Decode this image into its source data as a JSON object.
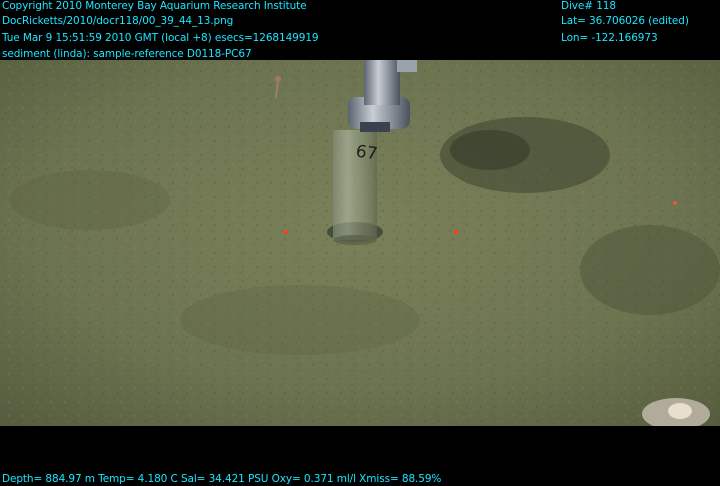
{
  "overlay": {
    "copyright": "Copyright 2010 Monterey Bay Aquarium Research Institute",
    "file_path": "DocRicketts/2010/docr118/00_39_44_13.png",
    "timestamp": "Tue Mar  9 15:51:59 2010 GMT (local +8)  esecs=1268149919",
    "annotation": "sediment (linda): sample-reference D0118-PC67",
    "dive": "Dive# 118",
    "latitude": "Lat= 36.706026 (edited)",
    "longitude": "Lon= -122.166973",
    "sensors": "Depth= 884.97 m  Temp= 4.180 C  Sal= 34.421 PSU  Oxy= 0.371 ml/l  Xmiss= 88.59%",
    "text_color": "#19e6ff"
  },
  "scene": {
    "core_label": "67",
    "seafloor_color": "#6e7651"
  }
}
